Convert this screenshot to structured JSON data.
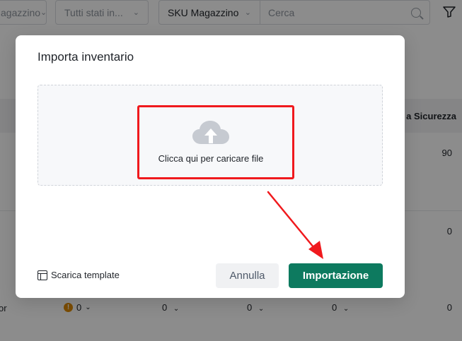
{
  "filters": {
    "magazzino_select": "agazzino",
    "stati_select": "Tutti stati in...",
    "sku_select": "SKU Magazzino",
    "search_placeholder": "Cerca"
  },
  "table": {
    "header_partial": "a Sicurezza",
    "row1_value": "90",
    "row2_value": "0",
    "row3": {
      "label_partial": "or",
      "values": [
        "0",
        "0",
        "0",
        "0",
        "0"
      ]
    }
  },
  "modal": {
    "title": "Importa inventario",
    "dropzone_text": "Clicca qui per caricare file",
    "template_link": "Scarica template",
    "cancel_label": "Annulla",
    "import_label": "Importazione"
  },
  "colors": {
    "primary": "#0d7a5f",
    "highlight": "#f0191d",
    "warning": "#e08a00"
  },
  "icons": {
    "search": "search-icon",
    "filter": "funnel-icon",
    "upload": "cloud-upload-icon",
    "template": "table-template-icon"
  }
}
